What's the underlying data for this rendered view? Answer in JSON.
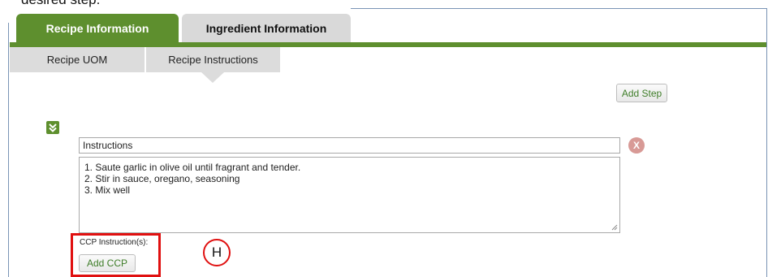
{
  "doc_text": "desired step.",
  "tabs": [
    {
      "label": "Recipe Information",
      "active": true
    },
    {
      "label": "Ingredient Information",
      "active": false
    }
  ],
  "subtabs": [
    {
      "label": "Recipe UOM",
      "active": false
    },
    {
      "label": "Recipe Instructions",
      "active": true
    }
  ],
  "actions": {
    "add_step_label": "Add Step"
  },
  "step": {
    "title_value": "Instructions",
    "delete_symbol": "X",
    "instructions": [
      "1. Saute garlic in olive oil until fragrant and tender.",
      "2. Stir in sauce, oregano, seasoning",
      "3. Mix well"
    ],
    "ccp_label": "CCP Instruction(s):",
    "add_ccp_label": "Add CCP"
  },
  "annotation": {
    "callout_letter": "H",
    "color": "#e01010"
  },
  "colors": {
    "brand_green": "#5e8f2e",
    "link_green": "#3e7d28",
    "tab_gray": "#d9d9d9"
  },
  "icons": {
    "collapse": "double-chevron-down-icon",
    "delete": "close-circle-icon"
  }
}
